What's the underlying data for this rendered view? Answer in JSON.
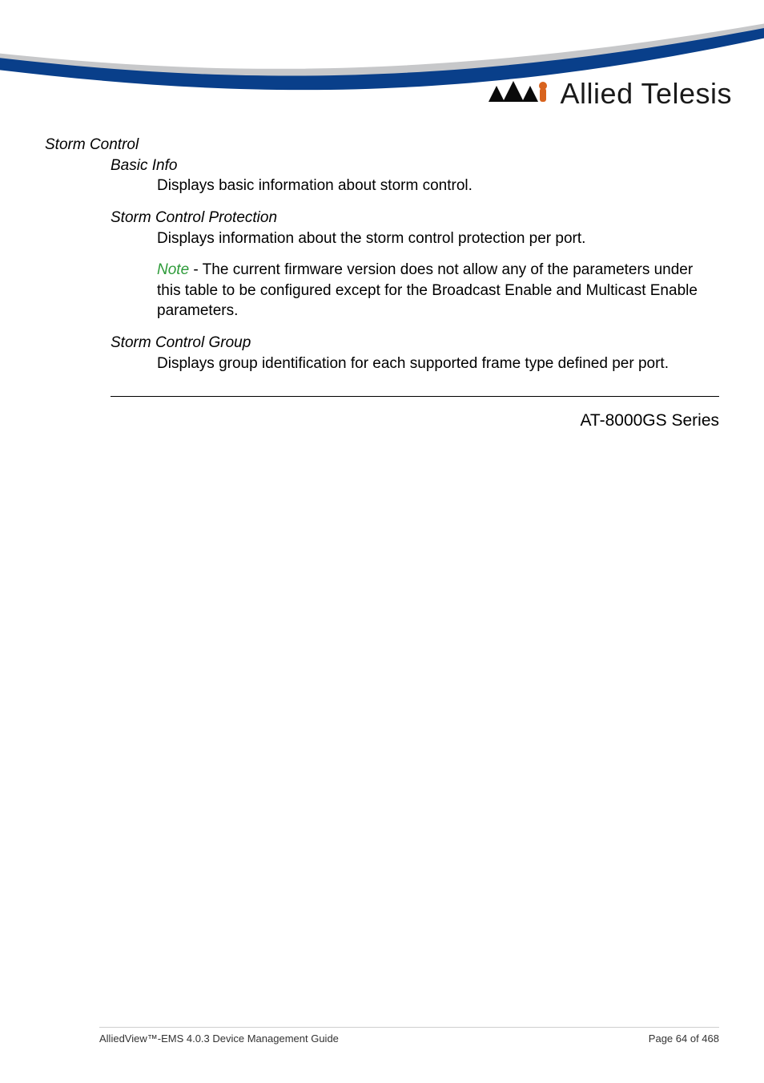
{
  "logo": {
    "company": "Allied Telesis"
  },
  "content": {
    "section": "Storm Control",
    "basicInfo": {
      "title": "Basic Info",
      "body": "Displays basic information about storm control."
    },
    "protection": {
      "title": "Storm Control Protection",
      "body": "Displays information about the storm control protection per port.",
      "noteLabel": "Note",
      "noteBody": " - The current firmware version does not allow any of the parameters under this table to be configured except for the Broadcast Enable and Multicast Enable parameters."
    },
    "group": {
      "title": "Storm Control Group",
      "body": "Displays group identification for each supported frame type defined per port."
    },
    "series": "AT-8000GS Series"
  },
  "footer": {
    "left": "AlliedView™-EMS 4.0.3 Device Management Guide",
    "right": "Page 64 of 468"
  }
}
